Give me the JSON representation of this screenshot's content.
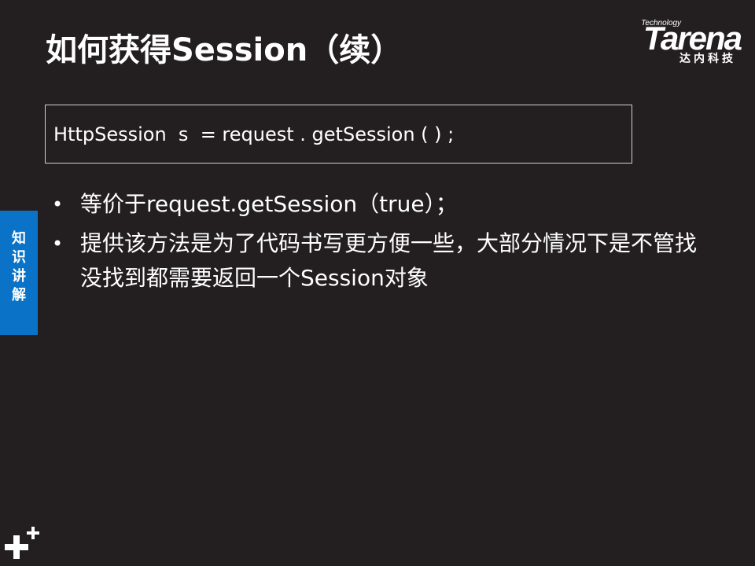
{
  "slide": {
    "title": "如何获得Session（续）",
    "code": "HttpSession  s  = request . getSession ( ) ;",
    "bullets": [
      "等价于request.getSession（true）；",
      "提供该方法是为了代码书写更方便一些，大部分情况下是不管找没找到都需要返回一个Session对象"
    ],
    "bullet_marker": "•"
  },
  "side_tab": {
    "label_lines": [
      "知",
      "识",
      "讲",
      "解"
    ]
  },
  "logo": {
    "technology": "Technology",
    "word": "Tarena",
    "sub": "达内科技"
  },
  "icons": {
    "corner": "plus-plus-icon"
  },
  "colors": {
    "background": "#231f20",
    "accent": "#0a73c7",
    "text": "#ffffff"
  }
}
